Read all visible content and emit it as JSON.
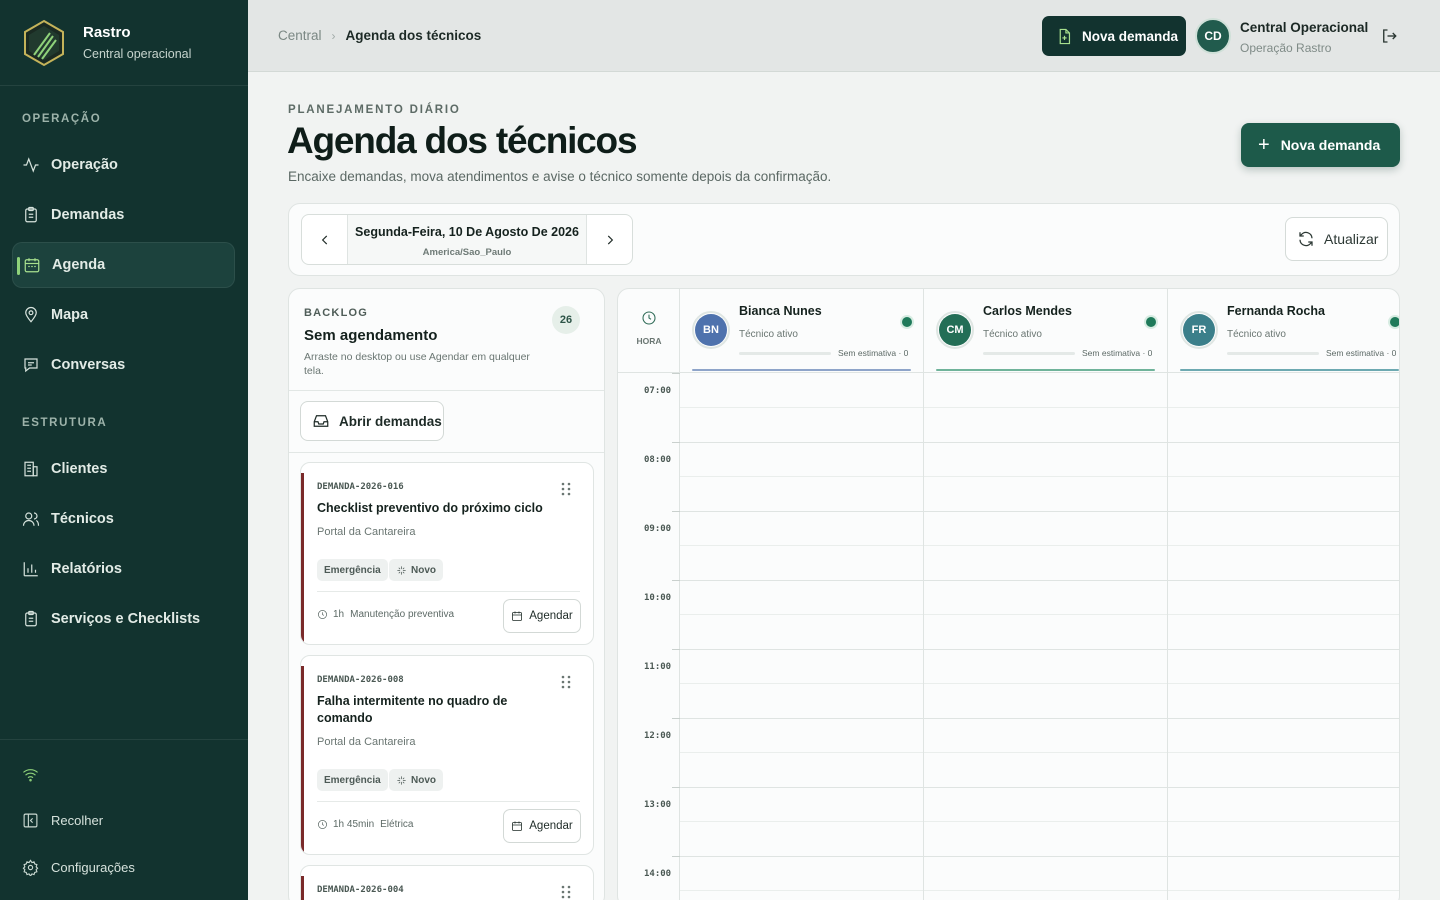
{
  "sidebar": {
    "brand": {
      "title": "Rastro",
      "subtitle": "Central operacional"
    },
    "sections": [
      {
        "label": "OPERAÇÃO"
      },
      {
        "label": "ESTRUTURA"
      }
    ],
    "items": [
      {
        "label": "Operação",
        "icon": "activity-icon"
      },
      {
        "label": "Demandas",
        "icon": "clipboard-icon"
      },
      {
        "label": "Agenda",
        "icon": "calendar-icon",
        "active": true
      },
      {
        "label": "Mapa",
        "icon": "map-pin-icon"
      },
      {
        "label": "Conversas",
        "icon": "chat-icon"
      },
      {
        "label": "Clientes",
        "icon": "building-icon"
      },
      {
        "label": "Técnicos",
        "icon": "users-icon"
      },
      {
        "label": "Relatórios",
        "icon": "bar-chart-icon"
      },
      {
        "label": "Serviços e Checklists",
        "icon": "checklist-icon"
      }
    ],
    "footer": {
      "collapse": "Recolher",
      "settings": "Configurações",
      "status_icon": "wifi-icon"
    }
  },
  "topbar": {
    "breadcrumb": {
      "home": "Central",
      "current": "Agenda dos técnicos"
    },
    "new_demand": "Nova demanda",
    "user": {
      "initials": "CD",
      "name": "Central Operacional",
      "role": "Operação Rastro"
    }
  },
  "header": {
    "eyebrow": "PLANEJAMENTO DIÁRIO",
    "title": "Agenda dos técnicos",
    "subtitle": "Encaixe demandas, mova atendimentos e avise o técnico somente depois da confirmação.",
    "primary_button": "Nova demanda"
  },
  "datebar": {
    "date": "Segunda-Feira, 10 De Agosto De 2026",
    "timezone": "America/Sao_Paulo",
    "refresh": "Atualizar"
  },
  "backlog": {
    "eyebrow": "BACKLOG",
    "title": "Sem agendamento",
    "description": "Arraste no desktop ou use Agendar em qualquer tela.",
    "count": "26",
    "open_button": "Abrir demandas",
    "cards": [
      {
        "code": "DEMANDA-2026-016",
        "title": "Checklist preventivo do próximo ciclo",
        "location": "Portal da Cantareira",
        "priority": "Emergência",
        "status": "Novo",
        "duration": "1h",
        "category": "Manutenção preventiva",
        "action": "Agendar"
      },
      {
        "code": "DEMANDA-2026-008",
        "title": "Falha intermitente no quadro de comando",
        "location": "Portal da Cantareira",
        "priority": "Emergência",
        "status": "Novo",
        "duration": "1h 45min",
        "category": "Elétrica",
        "action": "Agendar"
      },
      {
        "code": "DEMANDA-2026-004"
      }
    ]
  },
  "schedule": {
    "hour_header": "HORA",
    "hours": [
      "07:00",
      "08:00",
      "09:00",
      "10:00",
      "11:00",
      "12:00",
      "13:00",
      "14:00"
    ],
    "technicians": [
      {
        "initials": "BN",
        "name": "Bianca Nunes",
        "status": "Técnico ativo",
        "estimate": "Sem estimativa · 0",
        "color": "#4e72ad",
        "accent": "#8ea4c9"
      },
      {
        "initials": "CM",
        "name": "Carlos Mendes",
        "status": "Técnico ativo",
        "estimate": "Sem estimativa · 0",
        "color": "#236e56",
        "accent": "#6fb39a"
      },
      {
        "initials": "FR",
        "name": "Fernanda Rocha",
        "status": "Técnico ativo",
        "estimate": "Sem estimativa · 0",
        "color": "#3b7f8a",
        "accent": "#6da9b1"
      }
    ]
  },
  "colors": {
    "sidebar": "#12332f",
    "accent": "#1d5a4a",
    "highlight": "#8fd27a",
    "priority_bar": "#7a2a2a"
  }
}
